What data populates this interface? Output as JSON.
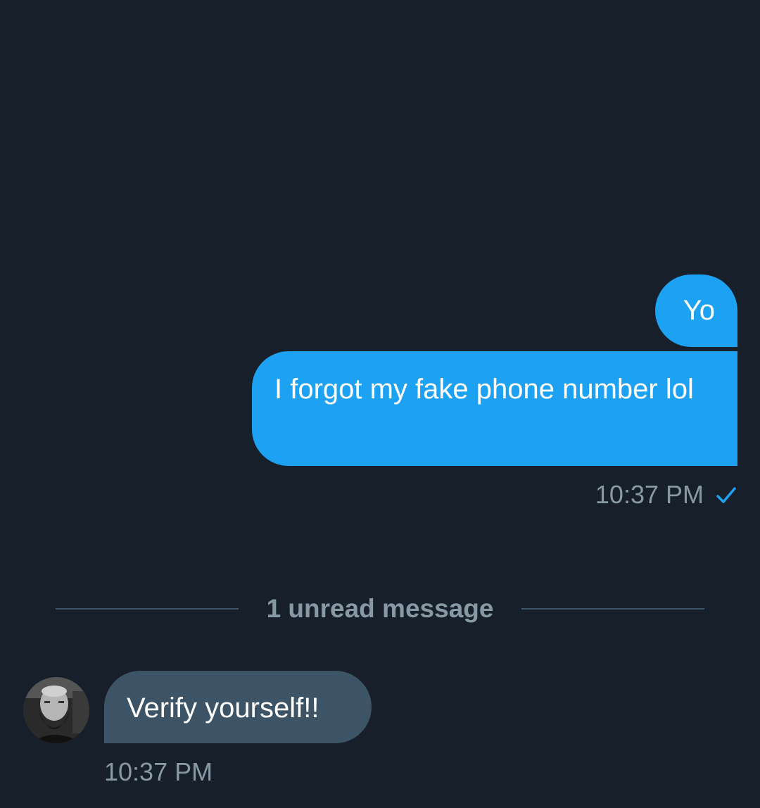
{
  "conversation": {
    "outgoing": [
      {
        "text": "Yo"
      },
      {
        "text": "I forgot my fake phone number lol"
      }
    ],
    "outgoing_time": "10:37 PM",
    "outgoing_status_icon": "check-icon",
    "unread_divider": "1 unread message",
    "incoming": {
      "text": "Verify yourself!!",
      "time": "10:37 PM",
      "avatar_icon": "avatar-photo"
    }
  },
  "colors": {
    "background": "#17202a",
    "outgoing_bubble": "#1da1f2",
    "incoming_bubble": "#3d5466",
    "meta_text": "#8899a6",
    "divider": "#3d5466"
  }
}
